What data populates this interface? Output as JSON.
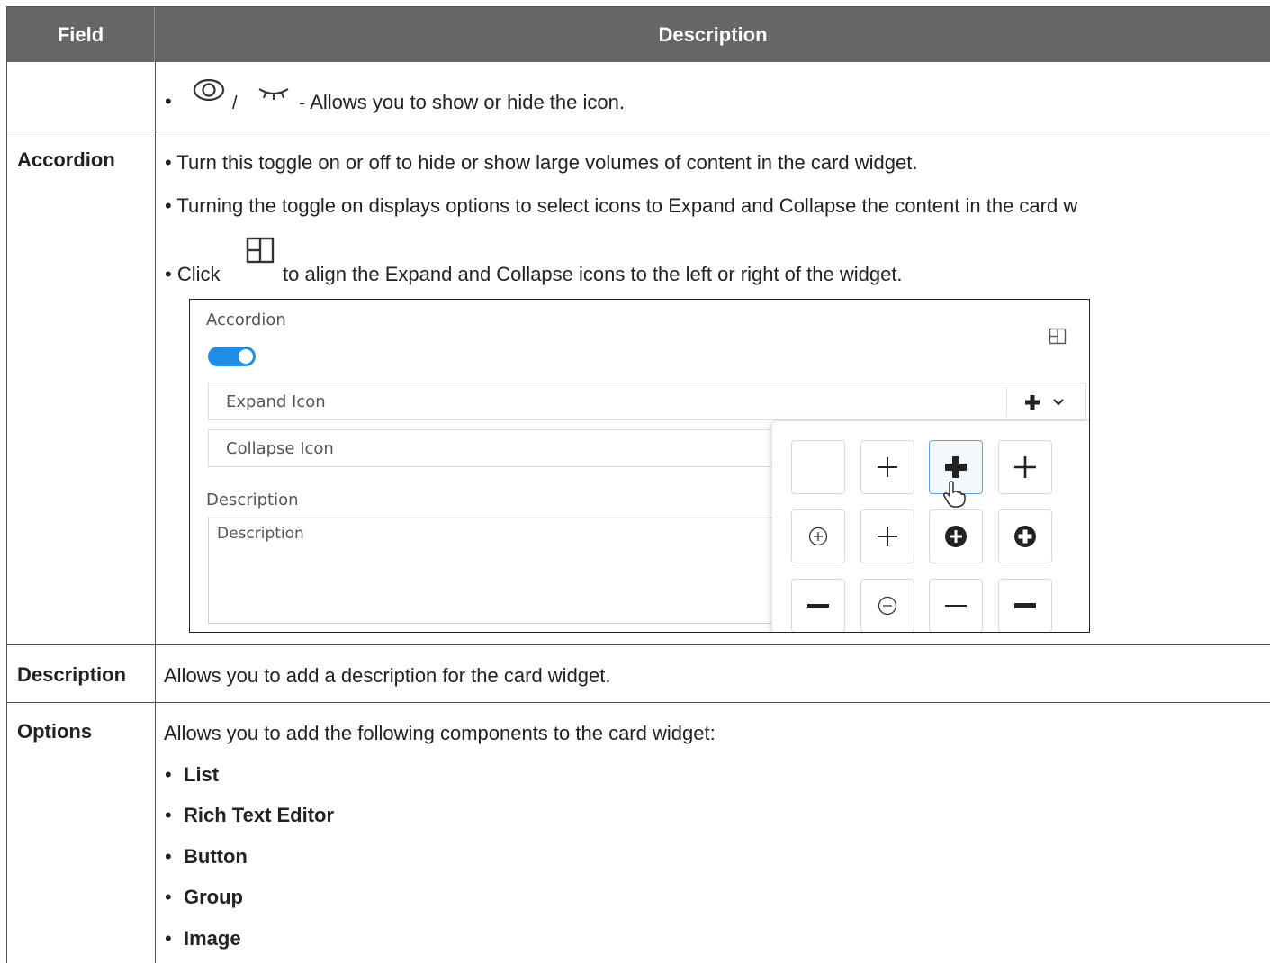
{
  "header": {
    "field": "Field",
    "description": "Description"
  },
  "row_icon": {
    "separator": "/",
    "text": "- Allows you to show or hide the icon.",
    "icons": [
      "eye-icon",
      "eye-closed-icon"
    ]
  },
  "row_accordion": {
    "field": "Accordion",
    "bullet1": "• Turn this toggle on or off to hide or show large volumes of content in the card widget.",
    "bullet2": "• Turning the toggle on displays options to select icons to Expand and Collapse the content in the card w",
    "bullet3_prefix": "• Click",
    "bullet3_suffix": "to align the Expand and Collapse icons to the left or right of the widget.",
    "screenshot": {
      "title": "Accordion",
      "toggle_on": true,
      "expand_label": "Expand Icon",
      "collapse_label": "Collapse Icon",
      "description_label": "Description",
      "description_placeholder": "Description",
      "icon_grid": [
        [
          "empty",
          "plus-thin",
          "plus-bold",
          "plus-medium"
        ],
        [
          "plus-circle-outline",
          "plus-thin",
          "plus-circle-filled",
          "plus-circle-filled-bold"
        ],
        [
          "minus-bold",
          "minus-circle-outline",
          "minus-thin",
          "minus-heavy"
        ]
      ],
      "selected_icon": "plus-bold",
      "accent": "#1f8ee6"
    }
  },
  "row_description": {
    "field": "Description",
    "text": "Allows you to add a description for the card widget."
  },
  "row_options": {
    "field": "Options",
    "intro": "Allows you to add the following components to the card widget:",
    "items": [
      "List",
      "Rich Text Editor",
      "Button",
      "Group",
      "Image"
    ],
    "bullet": "•"
  },
  "colors": {
    "header_bg": "#666666",
    "header_text": "#ffffff",
    "border": "#555555"
  }
}
